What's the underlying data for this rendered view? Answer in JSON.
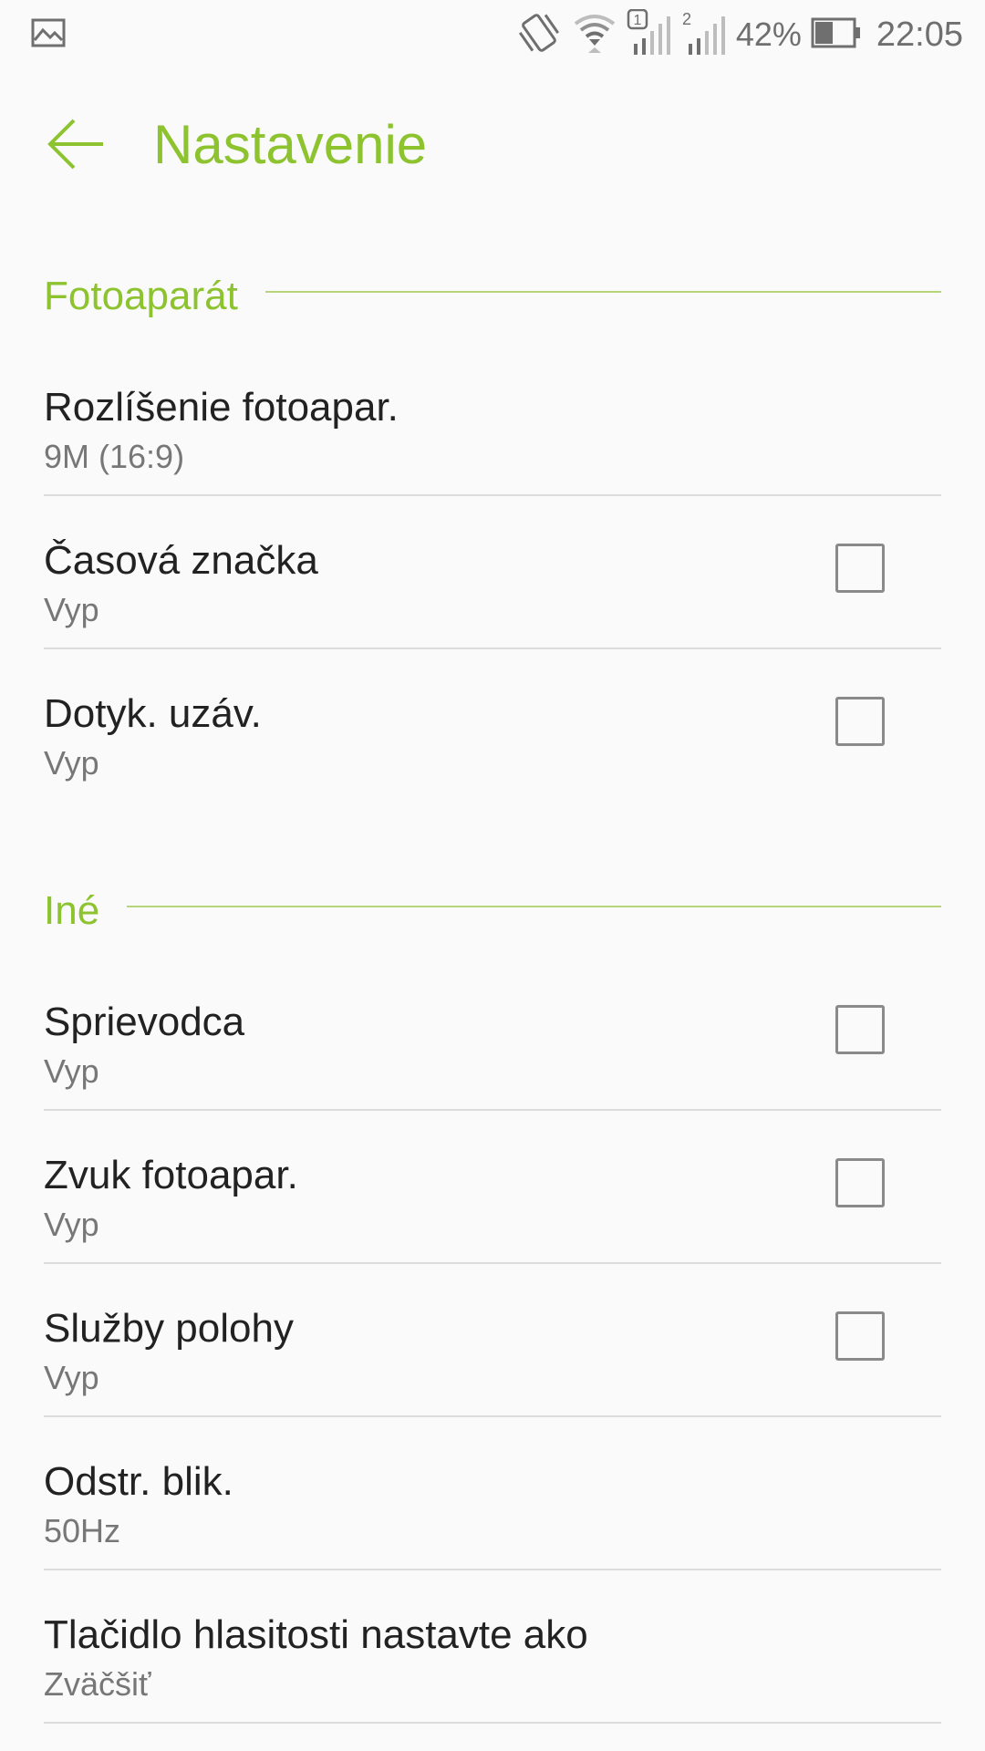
{
  "status_bar": {
    "battery_percent": "42%",
    "time": "22:05",
    "sim1_label": "1",
    "sim2_label": "2",
    "icons": [
      "gallery-icon",
      "vibrate-icon",
      "wifi-icon",
      "sim1-signal-icon",
      "sim2-signal-icon",
      "battery-icon"
    ]
  },
  "app_bar": {
    "title": "Nastavenie",
    "back_icon": "arrow-back-icon",
    "accent_color": "#8cc32f"
  },
  "sections": [
    {
      "title": "Fotoaparát",
      "items": [
        {
          "title": "Rozlíšenie fotoapar.",
          "summary": "9M (16:9)",
          "has_checkbox": false
        },
        {
          "title": "Časová značka",
          "summary": "Vyp",
          "has_checkbox": true,
          "checked": false
        },
        {
          "title": "Dotyk. uzáv.",
          "summary": "Vyp",
          "has_checkbox": true,
          "checked": false
        }
      ]
    },
    {
      "title": "Iné",
      "items": [
        {
          "title": "Sprievodca",
          "summary": "Vyp",
          "has_checkbox": true,
          "checked": false
        },
        {
          "title": "Zvuk fotoapar.",
          "summary": "Vyp",
          "has_checkbox": true,
          "checked": false
        },
        {
          "title": "Služby polohy",
          "summary": "Vyp",
          "has_checkbox": true,
          "checked": false
        },
        {
          "title": "Odstr. blik.",
          "summary": "50Hz",
          "has_checkbox": false
        },
        {
          "title": "Tlačidlo hlasitosti nastavte ako",
          "summary": "Zväčšiť",
          "has_checkbox": false
        }
      ]
    }
  ]
}
